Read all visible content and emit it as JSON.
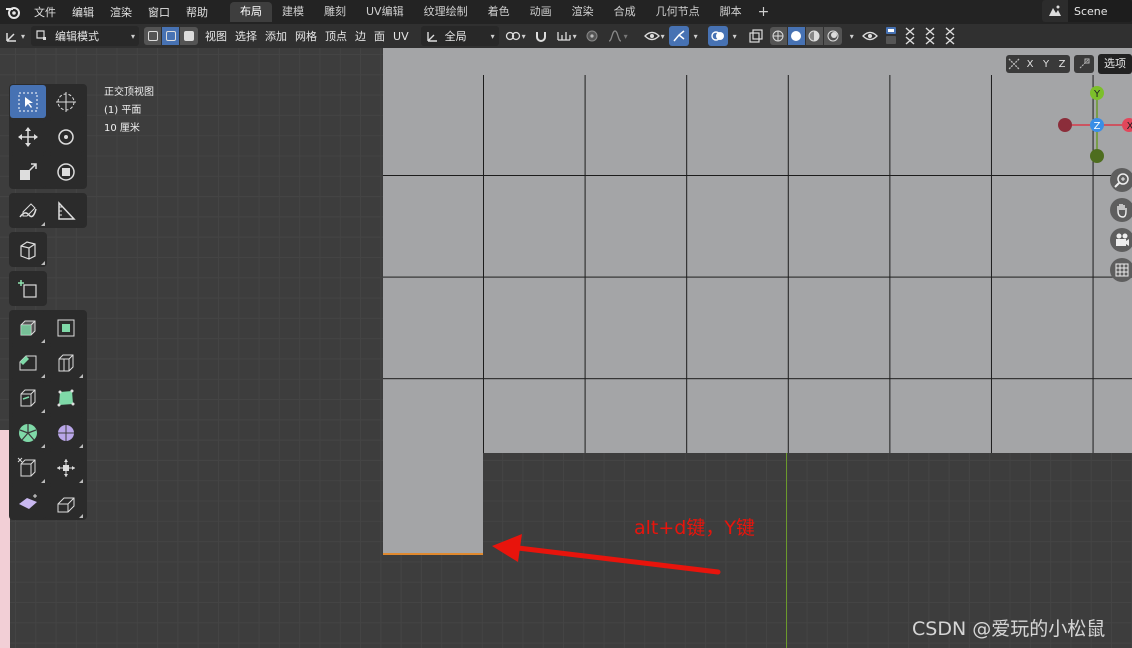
{
  "topbar": {
    "menus": [
      "文件",
      "编辑",
      "渲染",
      "窗口",
      "帮助"
    ],
    "workspace_tabs": [
      "布局",
      "建模",
      "雕刻",
      "UV编辑",
      "纹理绘制",
      "着色",
      "动画",
      "渲染",
      "合成",
      "几何节点",
      "脚本"
    ],
    "active_tab": "布局",
    "add_tab": "+",
    "scene": "Scene"
  },
  "header": {
    "mode": "编辑模式",
    "menus": [
      "视图",
      "选择",
      "添加",
      "网格",
      "顶点",
      "边",
      "面",
      "UV"
    ],
    "transform_orientation": "全局"
  },
  "viewport": {
    "view_name": "正交顶视图",
    "object_name": "(1) 平面",
    "grid_scale": "10 厘米",
    "axes": [
      "X",
      "Y",
      "Z"
    ],
    "options": "选项",
    "gizmo": {
      "y": "Y",
      "z": "Z",
      "x": "X"
    }
  },
  "annotation": {
    "text": "alt+d键，Y键",
    "color": "#e8140c"
  },
  "watermark": "CSDN @爱玩的小松鼠",
  "colors": {
    "accent": "#4772b3",
    "selected_edge": "#e0892e",
    "y_axis": "#6b9a2c",
    "x_axis": "#d93a4a",
    "z_axis": "#3a8ee6"
  }
}
